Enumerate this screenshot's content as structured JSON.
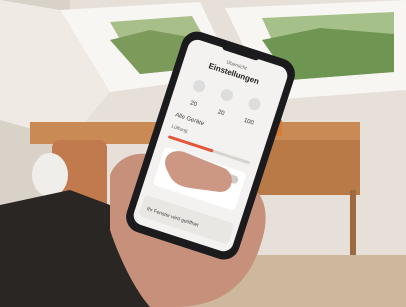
{
  "photo": {
    "subject": "hand-holding-smartphone-smart-home-app",
    "colors": {
      "wall": "#ebe6df",
      "window_frame": "#f6f5f2",
      "sky_green": "#8fa86c",
      "desk_wood": "#c98a55",
      "sleeve": "#2a2623",
      "skin": "#c6907a",
      "phone_body": "#1b1b1d",
      "screen_bg": "#f3f2f0",
      "accent_slider": "#e4563a"
    }
  },
  "app_screen": {
    "header_small": "Übersicht",
    "header_title": "Einstellungen",
    "section_label": "Alle Geräte",
    "values": [
      "20",
      "20",
      "100"
    ],
    "row_label": "Lüftung",
    "slider_level": 0.55,
    "bottom_note": "Ihr Fenster wird geöffnet"
  }
}
